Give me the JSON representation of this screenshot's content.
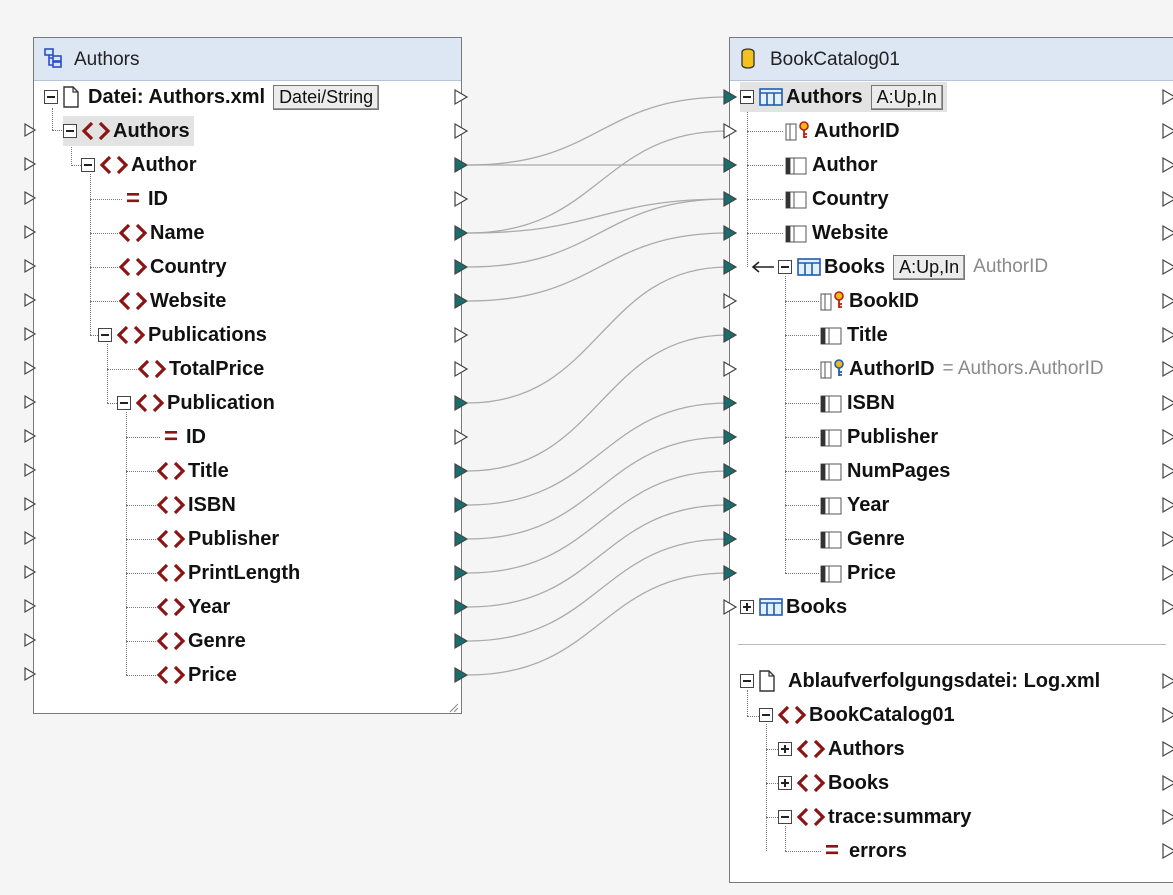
{
  "source": {
    "title": "Authors",
    "file_label": "Datei: Authors.xml",
    "file_button": "Datei/String",
    "items": [
      {
        "label": "Authors",
        "type": "element"
      },
      {
        "label": "Author",
        "type": "element"
      },
      {
        "label": "ID",
        "type": "attribute"
      },
      {
        "label": "Name",
        "type": "element"
      },
      {
        "label": "Country",
        "type": "element"
      },
      {
        "label": "Website",
        "type": "element"
      },
      {
        "label": "Publications",
        "type": "element"
      },
      {
        "label": "TotalPrice",
        "type": "element"
      },
      {
        "label": "Publication",
        "type": "element"
      },
      {
        "label": "ID",
        "type": "attribute"
      },
      {
        "label": "Title",
        "type": "element"
      },
      {
        "label": "ISBN",
        "type": "element"
      },
      {
        "label": "Publisher",
        "type": "element"
      },
      {
        "label": "PrintLength",
        "type": "element"
      },
      {
        "label": "Year",
        "type": "element"
      },
      {
        "label": "Genre",
        "type": "element"
      },
      {
        "label": "Price",
        "type": "element"
      }
    ]
  },
  "target": {
    "title": "BookCatalog01",
    "authors_table": "Authors",
    "authors_action": "A:Up,In",
    "columns_authors": [
      "AuthorID",
      "Author",
      "Country",
      "Website"
    ],
    "books_table": "Books",
    "books_action": "A:Up,In",
    "books_key": "AuthorID",
    "columns_books": [
      "BookID",
      "Title",
      "AuthorID",
      "ISBN",
      "Publisher",
      "NumPages",
      "Year",
      "Genre",
      "Price"
    ],
    "authorid_expr": "= Authors.AuthorID",
    "books_root": "Books",
    "log_file": "Ablaufverfolgungsdatei: Log.xml",
    "log_root": "BookCatalog01",
    "log_items": [
      "Authors",
      "Books",
      "trace:summary"
    ],
    "log_errors": "errors"
  },
  "colors": {
    "connector": "#1a6d6d",
    "element_icon": "#8b1414",
    "title_bar": "#dde6f3"
  }
}
